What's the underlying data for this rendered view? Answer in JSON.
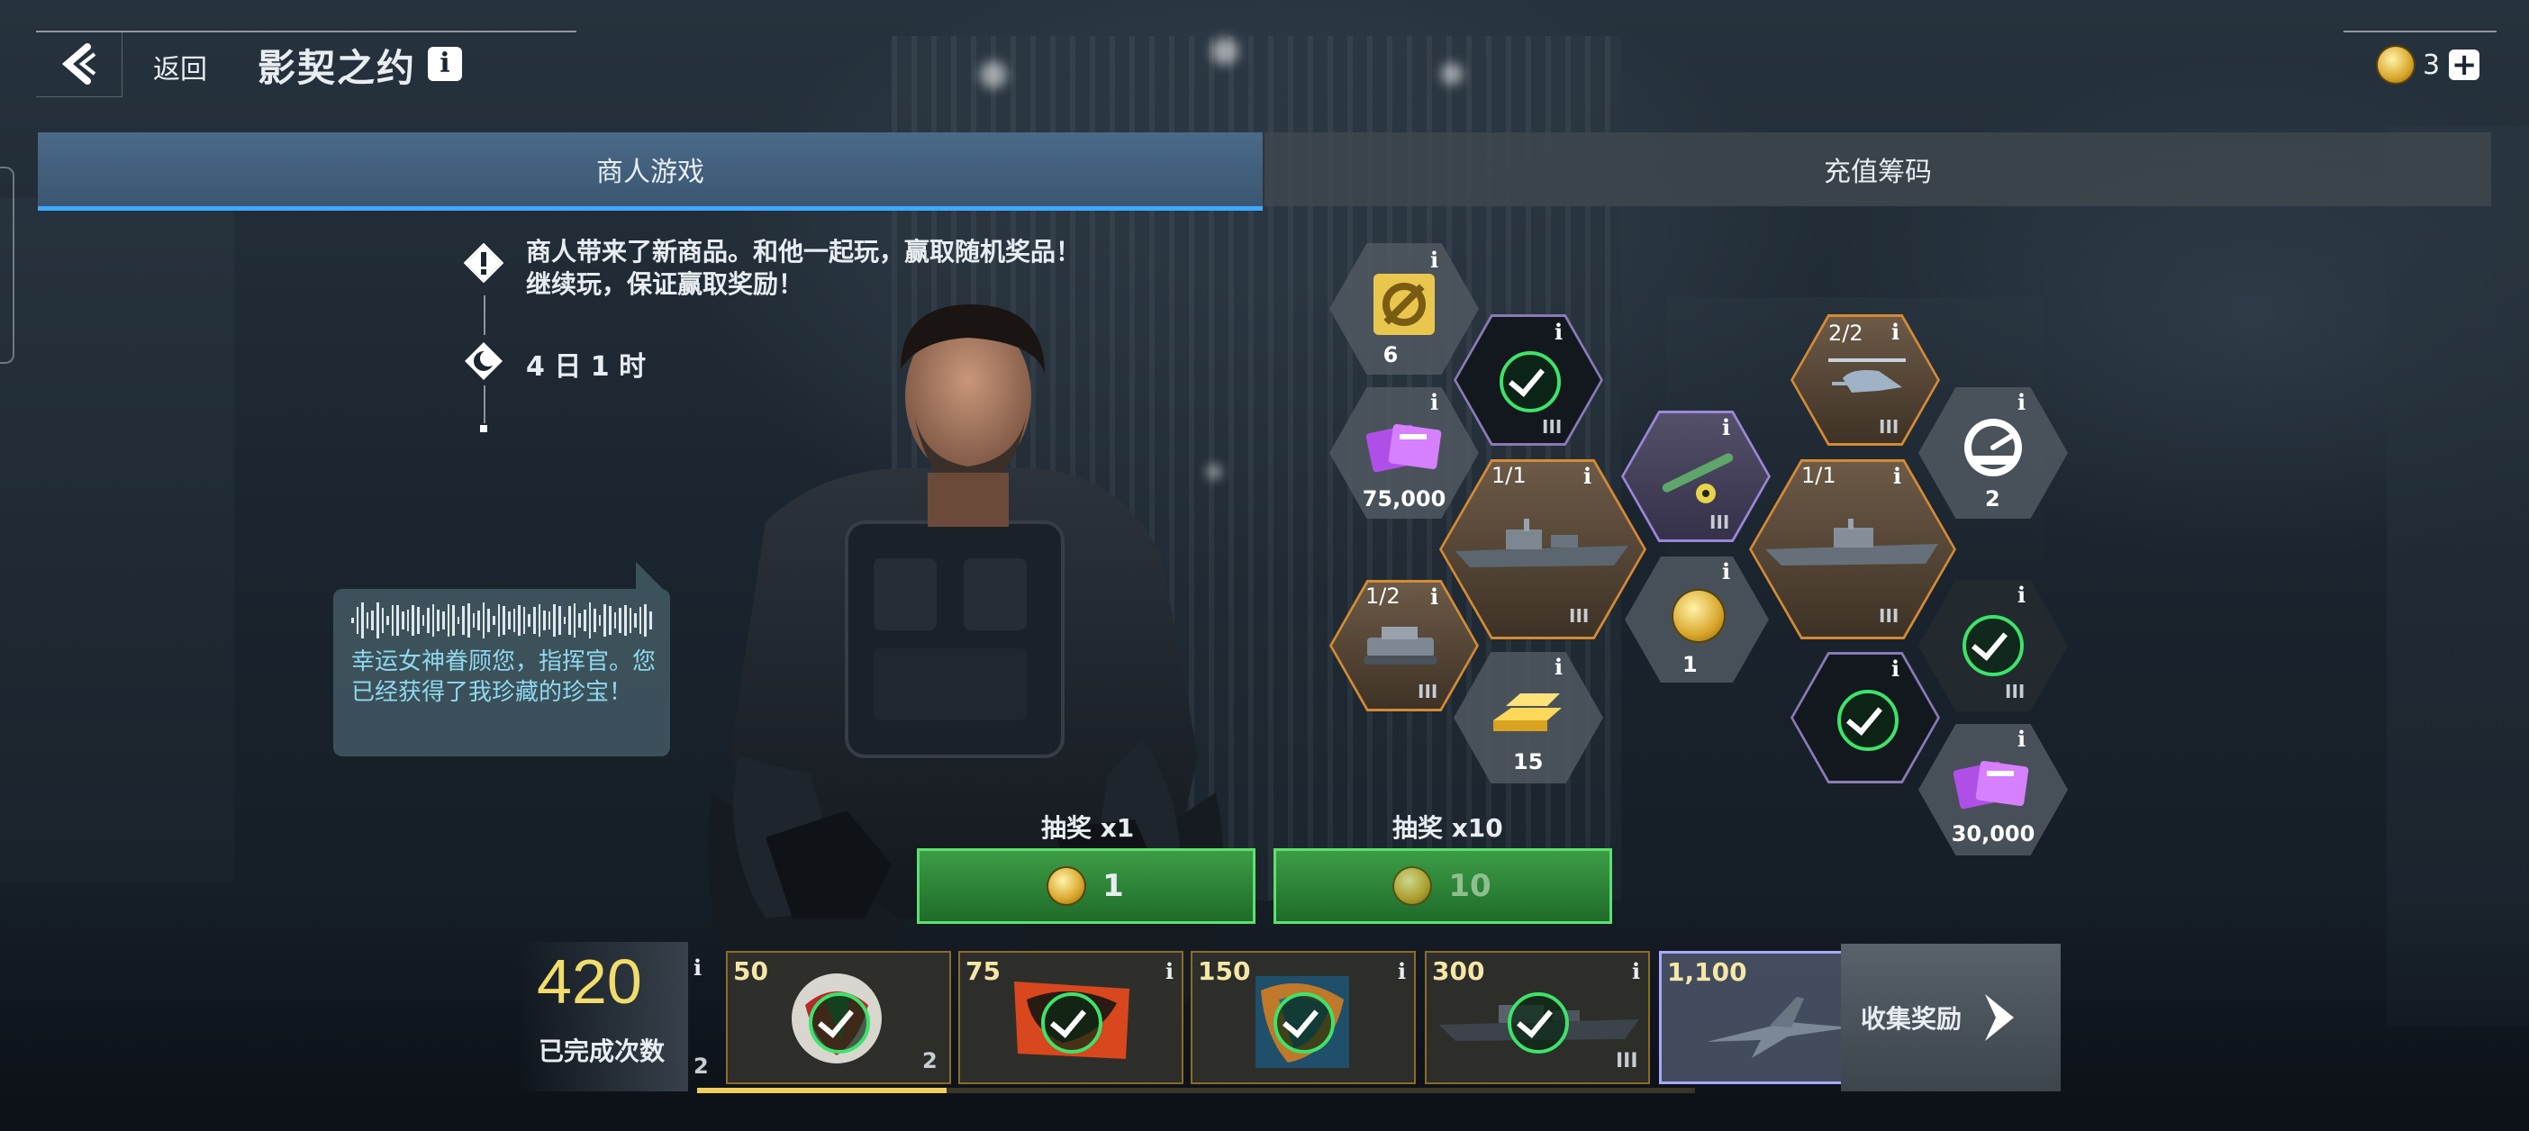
{
  "header": {
    "back_label": "返回",
    "title": "影契之约",
    "currency_count": "3"
  },
  "tabs": [
    {
      "label": "商人游戏",
      "active": true
    },
    {
      "label": "充值筹码",
      "active": false
    }
  ],
  "event": {
    "description_line1": "商人带来了新商品。和他一起玩，赢取随机奖品！",
    "description_line2": "继续玩，保证赢取奖励！",
    "timer": "4 日 1 时"
  },
  "speech": {
    "text": "幸运女神眷顾您，指挥官。您已经获得了我珍藏的珍宝！"
  },
  "rewards": {
    "parts_count": "6",
    "crystal_count_1": "75,000",
    "ship1_fraction": "1/1",
    "ship1_tier": "III",
    "missile_tier": "III",
    "ship2_fraction": "1/1",
    "ship2_tier": "III",
    "helicopter_fraction": "2/2",
    "helicopter_tier": "III",
    "speed_count": "2",
    "tank_fraction": "1/2",
    "tank_tier": "III",
    "gold_count": "15",
    "coin_count": "1",
    "crystal_count_2": "30,000",
    "claimed1_tier": "III",
    "claimed2_tier": "III"
  },
  "draw": {
    "single_label": "抽奖 x1",
    "single_cost": "1",
    "ten_label": "抽奖 x10",
    "ten_cost": "10"
  },
  "milestones": {
    "completed_count": "420",
    "completed_label": "已完成次数",
    "items": [
      {
        "threshold": "50",
        "corner": "2"
      },
      {
        "threshold": "75",
        "corner": ""
      },
      {
        "threshold": "150",
        "corner": ""
      },
      {
        "threshold": "300",
        "corner": "III"
      },
      {
        "threshold": "1,100",
        "corner": ""
      }
    ],
    "left_corner": "2",
    "collect_label": "收集奖励",
    "progress": 0.25
  },
  "colors": {
    "accent_blue": "#3fa9ff",
    "draw_green": "#2e8a39",
    "check_green": "#3de36a",
    "gold": "#f2dc6b"
  }
}
